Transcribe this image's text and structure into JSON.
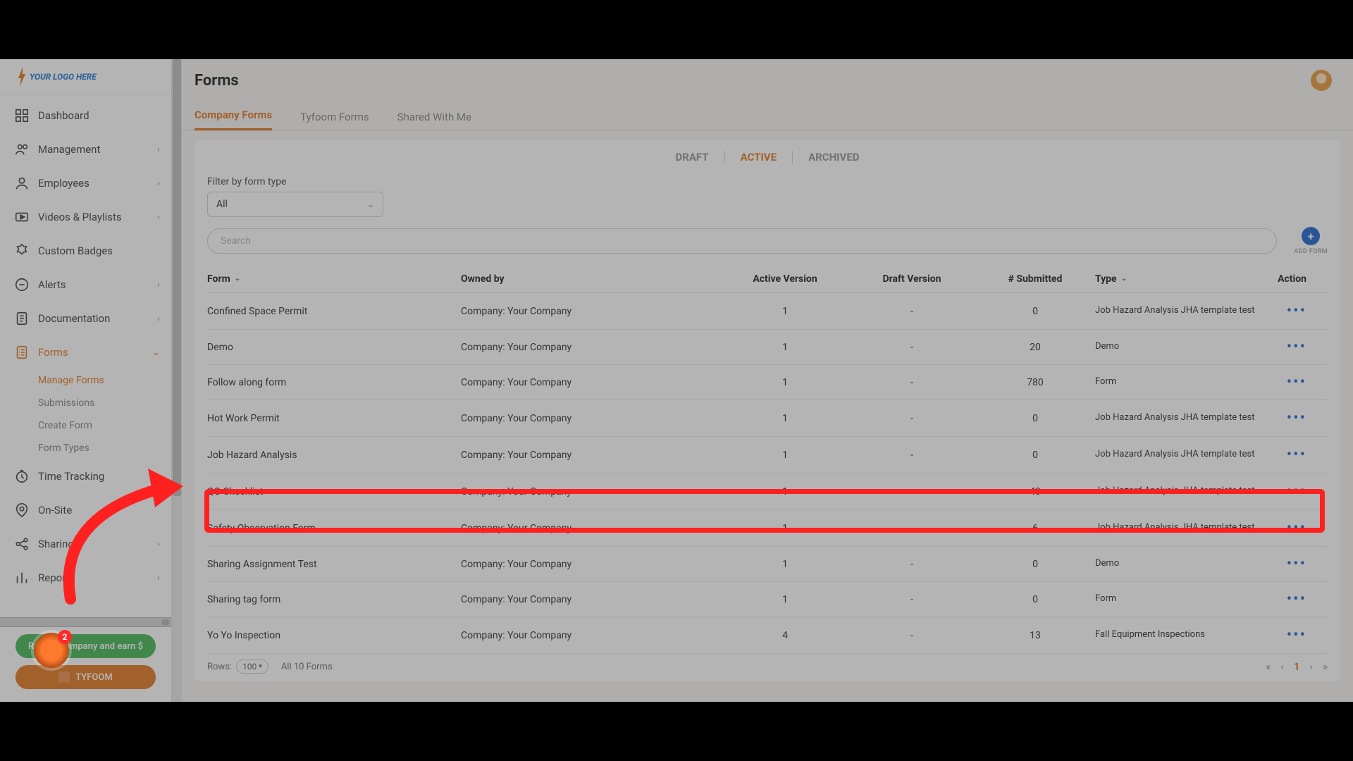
{
  "logo": {
    "text": "YOUR LOGO HERE"
  },
  "header": {
    "title": "Forms"
  },
  "sidebar": {
    "items": [
      {
        "label": "Dashboard",
        "icon": "dashboard-icon",
        "expandable": false
      },
      {
        "label": "Management",
        "icon": "management-icon",
        "expandable": true
      },
      {
        "label": "Employees",
        "icon": "employees-icon",
        "expandable": true
      },
      {
        "label": "Videos & Playlists",
        "icon": "videos-icon",
        "expandable": true
      },
      {
        "label": "Custom Badges",
        "icon": "badges-icon",
        "expandable": false
      },
      {
        "label": "Alerts",
        "icon": "alerts-icon",
        "expandable": true
      },
      {
        "label": "Documentation",
        "icon": "documentation-icon",
        "expandable": true
      },
      {
        "label": "Forms",
        "icon": "forms-icon",
        "expandable": true,
        "active": true
      },
      {
        "label": "Time Tracking",
        "icon": "time-tracking-icon",
        "expandable": true
      },
      {
        "label": "On-Site",
        "icon": "onsite-icon",
        "expandable": false
      },
      {
        "label": "Sharing",
        "icon": "sharing-icon",
        "expandable": true
      },
      {
        "label": "Reports",
        "icon": "reports-icon",
        "expandable": true
      }
    ],
    "forms_sub": [
      {
        "label": "Manage Forms",
        "active": true
      },
      {
        "label": "Submissions"
      },
      {
        "label": "Create Form"
      },
      {
        "label": "Form Types"
      }
    ],
    "refer_btn": "Refer a company and earn $",
    "tyfoom_btn": "TYFOOM",
    "badge_count": "2"
  },
  "tabs": {
    "items": [
      "Company Forms",
      "Tyfoom Forms",
      "Shared With Me"
    ],
    "active": 0
  },
  "status_tabs": {
    "items": [
      "DRAFT",
      "ACTIVE",
      "ARCHIVED"
    ],
    "active": 1
  },
  "filter": {
    "label": "Filter by form type",
    "value": "All"
  },
  "search": {
    "placeholder": "Search"
  },
  "add_form": {
    "label": "ADD FORM"
  },
  "table": {
    "headers": {
      "form": "Form",
      "owned": "Owned by",
      "active_v": "Active Version",
      "draft_v": "Draft Version",
      "submitted": "# Submitted",
      "type": "Type",
      "action": "Action"
    },
    "rows": [
      {
        "form": "Confined Space Permit",
        "owned": "Company: Your Company",
        "active_v": "1",
        "draft_v": "-",
        "submitted": "0",
        "type": "Job Hazard Analysis JHA template test"
      },
      {
        "form": "Demo",
        "owned": "Company: Your Company",
        "active_v": "1",
        "draft_v": "-",
        "submitted": "20",
        "type": "Demo"
      },
      {
        "form": "Follow along form",
        "owned": "Company: Your Company",
        "active_v": "1",
        "draft_v": "-",
        "submitted": "780",
        "type": "Form"
      },
      {
        "form": "Hot Work Permit",
        "owned": "Company: Your Company",
        "active_v": "1",
        "draft_v": "-",
        "submitted": "0",
        "type": "Job Hazard Analysis JHA template test"
      },
      {
        "form": "Job Hazard Analysis",
        "owned": "Company: Your Company",
        "active_v": "1",
        "draft_v": "-",
        "submitted": "0",
        "type": "Job Hazard Analysis JHA template test"
      },
      {
        "form": "QC Checklist",
        "owned": "Company: Your Company",
        "active_v": "1",
        "draft_v": "-",
        "submitted": "40",
        "type": "Job Hazard Analysis JHA template test",
        "highlight": true
      },
      {
        "form": "Safety Observation Form",
        "owned": "Company: Your Company",
        "active_v": "1",
        "draft_v": "-",
        "submitted": "6",
        "type": "Job Hazard Analysis JHA template test"
      },
      {
        "form": "Sharing Assignment Test",
        "owned": "Company: Your Company",
        "active_v": "1",
        "draft_v": "-",
        "submitted": "0",
        "type": "Demo"
      },
      {
        "form": "Sharing tag form",
        "owned": "Company: Your Company",
        "active_v": "1",
        "draft_v": "-",
        "submitted": "0",
        "type": "Form"
      },
      {
        "form": "Yo Yo Inspection",
        "owned": "Company: Your Company",
        "active_v": "4",
        "draft_v": "-",
        "submitted": "13",
        "type": "Fall Equipment Inspections"
      }
    ]
  },
  "footer": {
    "rows_label": "Rows:",
    "rows_value": "100",
    "count_text": "All 10 Forms",
    "page": "1"
  }
}
